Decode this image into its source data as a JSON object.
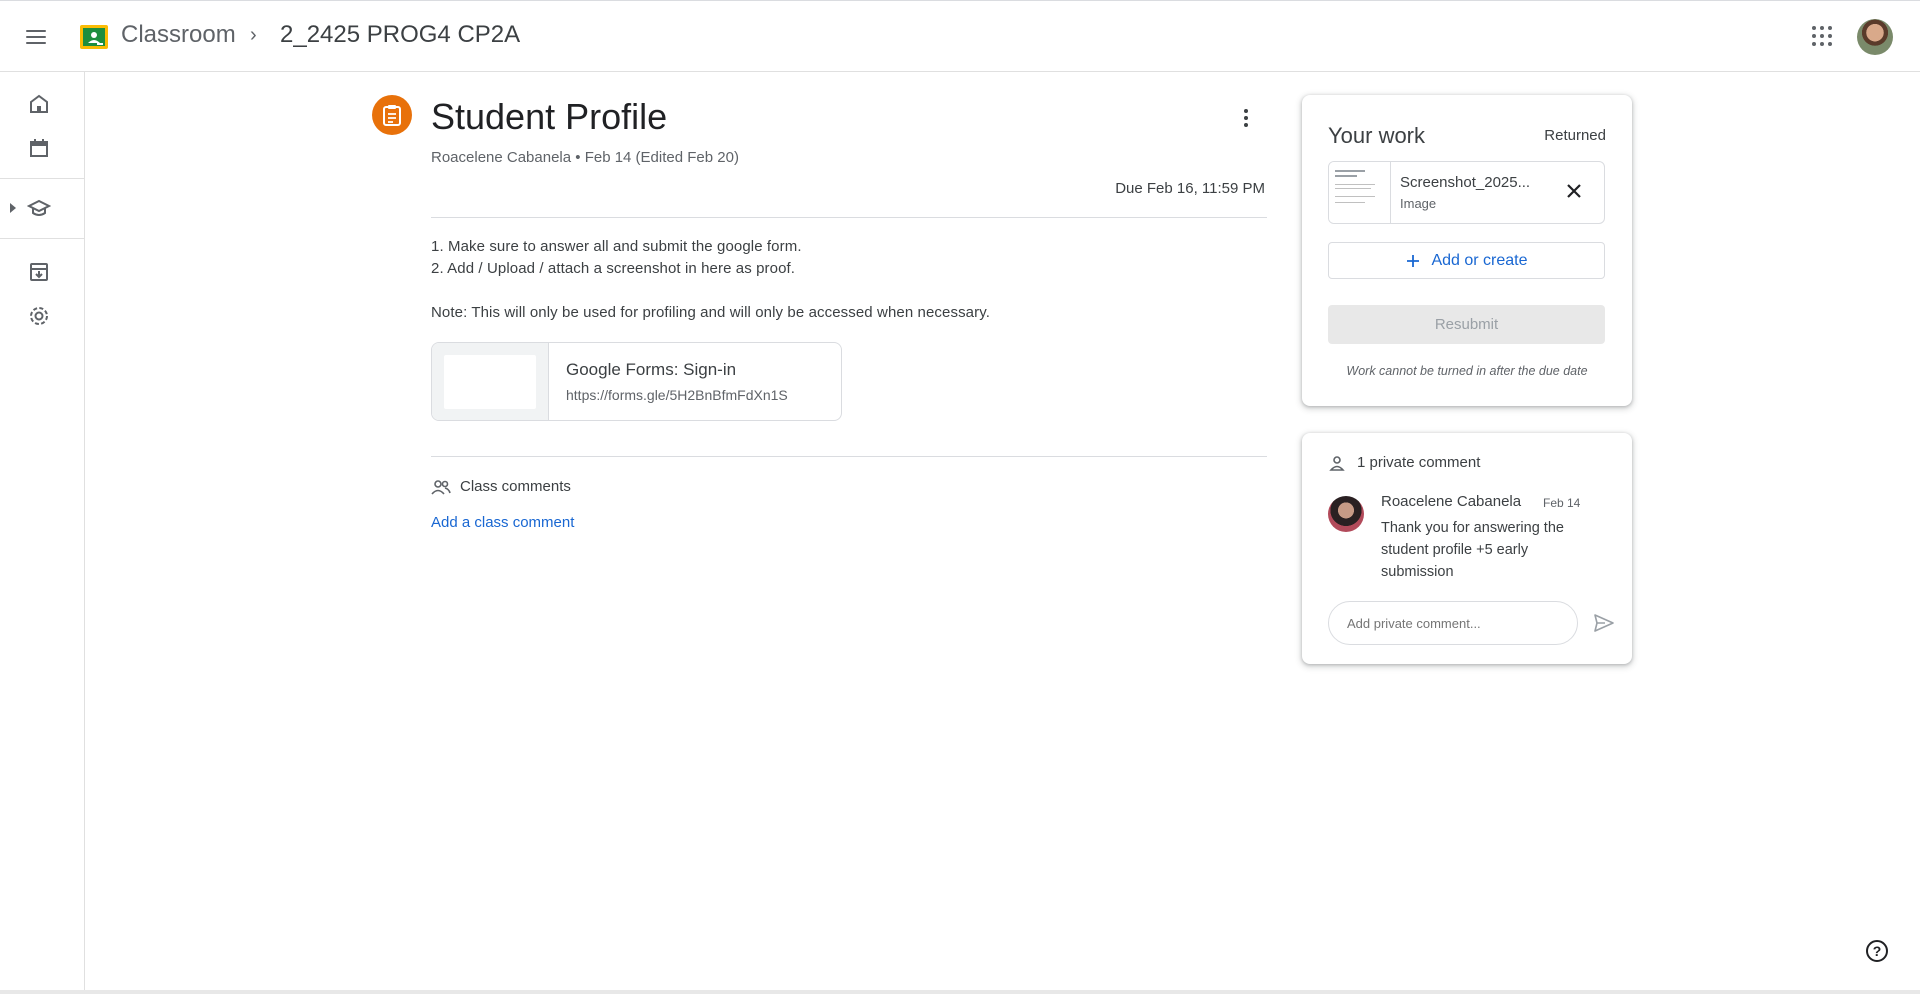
{
  "header": {
    "app_name": "Classroom",
    "breadcrumb_separator": "›",
    "class_name": "2_2425 PROG4 CP2A"
  },
  "assignment": {
    "title": "Student Profile",
    "meta": "Roacelene Cabanela • Feb 14 (Edited Feb 20)",
    "due": "Due Feb 16, 11:59 PM",
    "instructions": [
      "1. Make sure to answer all and submit the google form.",
      "2. Add / Upload / attach a screenshot in here as proof.",
      "Note: This will only be used for profiling and will only be accessed when necessary."
    ],
    "attachment": {
      "title": "Google Forms: Sign-in",
      "url": "https://forms.gle/5H2BnBfmFdXn1S"
    },
    "class_comments": {
      "label": "Class comments",
      "add_link": "Add a class comment"
    }
  },
  "your_work": {
    "title": "Your work",
    "status": "Returned",
    "file": {
      "name": "Screenshot_2025...",
      "type": "Image"
    },
    "add_button": "Add or create",
    "resubmit_button": "Resubmit",
    "note": "Work cannot be turned in after the due date"
  },
  "private_comments": {
    "title": "1 private comment",
    "comment": {
      "author": "Roacelene Cabanela",
      "date": "Feb 14",
      "text": "Thank you for answering the student profile +5 early submission"
    },
    "input_placeholder": "Add private comment..."
  },
  "colors": {
    "accent_blue": "#1967d2",
    "assignment_orange": "#e8710a",
    "classroom_green": "#1e8e3e",
    "classroom_yellow": "#fbbc04"
  },
  "icons": {
    "top": [
      "menu-icon",
      "classroom-logo-icon",
      "chevron-right-icon",
      "apps-grid-icon"
    ],
    "sidebar": [
      "home-icon",
      "calendar-icon",
      "expand-arrow-icon",
      "enrolled-classes-icon",
      "archive-icon",
      "settings-icon"
    ],
    "content": [
      "assignment-icon",
      "more-vert-icon",
      "people-icon",
      "close-icon",
      "plus-icon",
      "person-icon",
      "send-icon",
      "help-icon"
    ]
  }
}
